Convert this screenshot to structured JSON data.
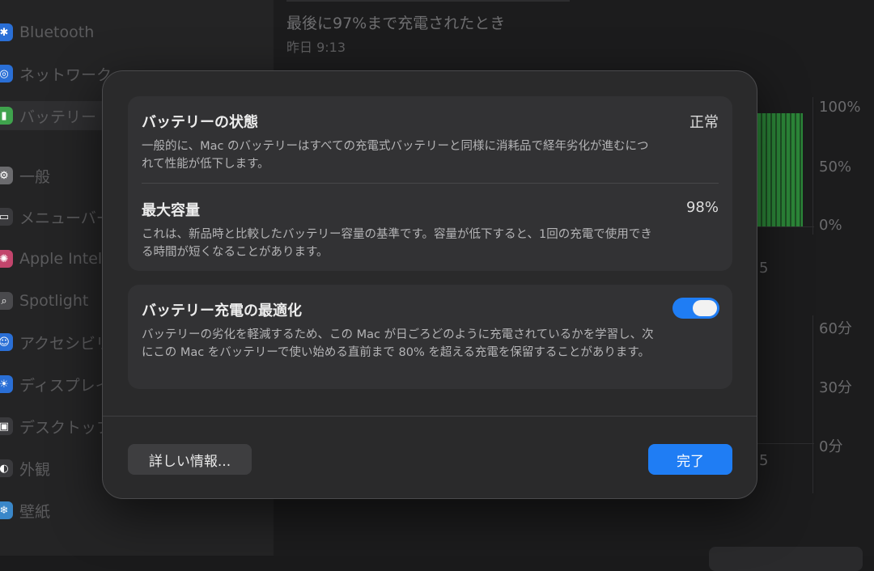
{
  "sidebar": {
    "items": [
      {
        "label": "Bluetooth",
        "icon": "bluetooth-icon",
        "color": "#2a6fd6"
      },
      {
        "label": "ネットワーク",
        "icon": "globe-icon",
        "color": "#2a6fd6"
      },
      {
        "label": "バッテリー",
        "icon": "battery-icon",
        "color": "#3fa34d"
      },
      {
        "label": "一般",
        "icon": "gear-icon",
        "color": "#6b6b6e"
      },
      {
        "label": "メニューバー",
        "icon": "menubar-icon",
        "color": "#3a3a3d"
      },
      {
        "label": "Apple Intelligence",
        "icon": "apple-intelligence-icon",
        "color": "#c2456c"
      },
      {
        "label": "Spotlight",
        "icon": "search-icon",
        "color": "#4a4a4d"
      },
      {
        "label": "アクセシビリティ",
        "icon": "accessibility-icon",
        "color": "#2a6fd6"
      },
      {
        "label": "ディスプレイ",
        "icon": "sun-icon",
        "color": "#2a6fd6"
      },
      {
        "label": "デスクトップ",
        "icon": "desktop-icon",
        "color": "#3a3a3d"
      },
      {
        "label": "外観",
        "icon": "appearance-icon",
        "color": "#3a3a3d"
      },
      {
        "label": "壁紙",
        "icon": "wallpaper-icon",
        "color": "#3a87c9"
      }
    ]
  },
  "background": {
    "last_charged_title": "最後に97%まで充電されたとき",
    "last_charged_time": "昨日 9:13",
    "level_axis": [
      "100%",
      "50%",
      "0%"
    ],
    "usage_axis": [
      "60分",
      "30分",
      "0分"
    ],
    "stray_label_1": "5",
    "stray_label_2": "5"
  },
  "modal": {
    "battery_health": {
      "title": "バッテリーの状態",
      "value": "正常",
      "description": "一般的に、Mac のバッテリーはすべての充電式バッテリーと同様に消耗品で経年劣化が進むにつれて性能が低下します。"
    },
    "max_capacity": {
      "title": "最大容量",
      "value": "98%",
      "description": "これは、新品時と比較したバッテリー容量の基準です。容量が低下すると、1回の充電で使用できる時間が短くなることがあります。"
    },
    "optimized_charging": {
      "title": "バッテリー充電の最適化",
      "enabled": true,
      "description": "バッテリーの劣化を軽減するため、この Mac が日ごろどのように充電されているかを学習し、次にこの Mac をバッテリーで使い始める直前まで 80% を超える充電を保留することがあります。"
    },
    "more_info_button": "詳しい情報...",
    "done_button": "完了"
  },
  "colors": {
    "accent": "#1f7df4",
    "battery_green": "#2f9a3e"
  }
}
